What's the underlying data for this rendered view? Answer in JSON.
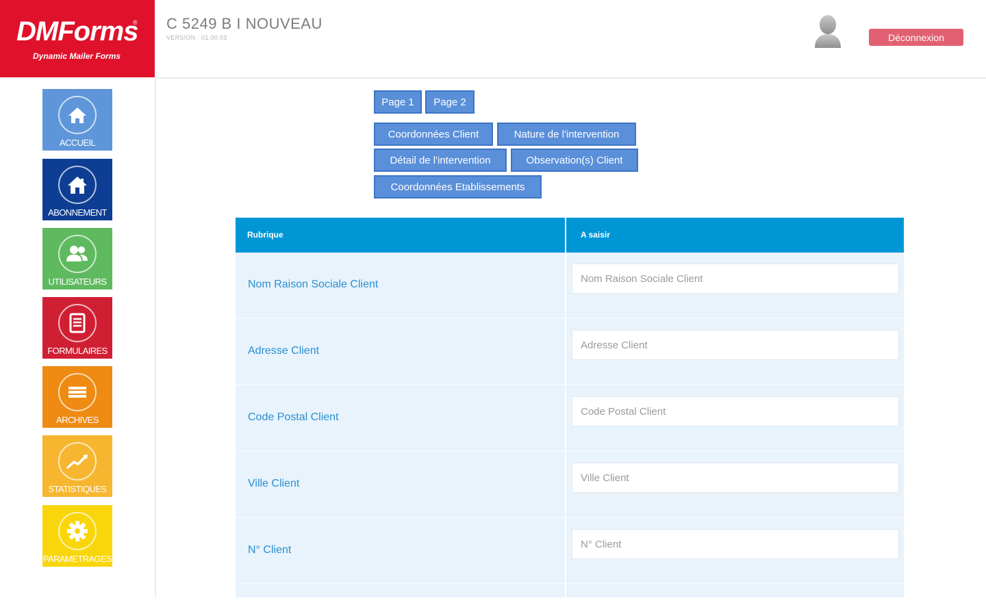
{
  "logo": {
    "title": "DMForms",
    "registered": "®",
    "subtitle": "Dynamic Mailer Forms"
  },
  "header": {
    "title": "C 5249 B I NOUVEAU",
    "version": "VERSION : 01.00.03",
    "logout_label": "Déconnexion"
  },
  "sidebar": {
    "items": [
      {
        "label": "ACCUEIL",
        "icon": "home-icon",
        "color": "#5f96d9"
      },
      {
        "label": "ABONNEMENT",
        "icon": "house-icon",
        "color": "#0d3e93"
      },
      {
        "label": "UTILISATEURS",
        "icon": "users-icon",
        "color": "#5fba5f"
      },
      {
        "label": "FORMULAIRES",
        "icon": "forms-icon",
        "color": "#d01f33"
      },
      {
        "label": "ARCHIVES",
        "icon": "archives-icon",
        "color": "#ef8a13"
      },
      {
        "label": "STATISTIQUES",
        "icon": "chart-icon",
        "color": "#f7b62f"
      },
      {
        "label": "PARAMETRAGES",
        "icon": "gear-icon",
        "color": "#f8d60b"
      }
    ]
  },
  "pages": [
    "Page 1",
    "Page 2"
  ],
  "sections": [
    "Coordonnées Client",
    "Nature de l'intervention",
    "Détail de l'intervention",
    "Observation(s) Client",
    "Coordonnées Etablissements"
  ],
  "table": {
    "headers": [
      "Rubrique",
      "A saisir"
    ],
    "rows": [
      {
        "label": "Nom Raison Sociale Client",
        "placeholder": "Nom Raison Sociale Client"
      },
      {
        "label": "Adresse Client",
        "placeholder": "Adresse Client"
      },
      {
        "label": "Code Postal Client",
        "placeholder": "Code Postal Client"
      },
      {
        "label": "Ville Client",
        "placeholder": "Ville Client"
      },
      {
        "label": "N° Client",
        "placeholder": "N° Client"
      }
    ]
  },
  "colors": {
    "brand_red": "#e0112b",
    "tab_blue": "#5a8fd9",
    "table_header": "#0096d6",
    "row_bg": "#e8f3fc",
    "label_blue": "#2a8fd2",
    "logout": "#e16172"
  }
}
